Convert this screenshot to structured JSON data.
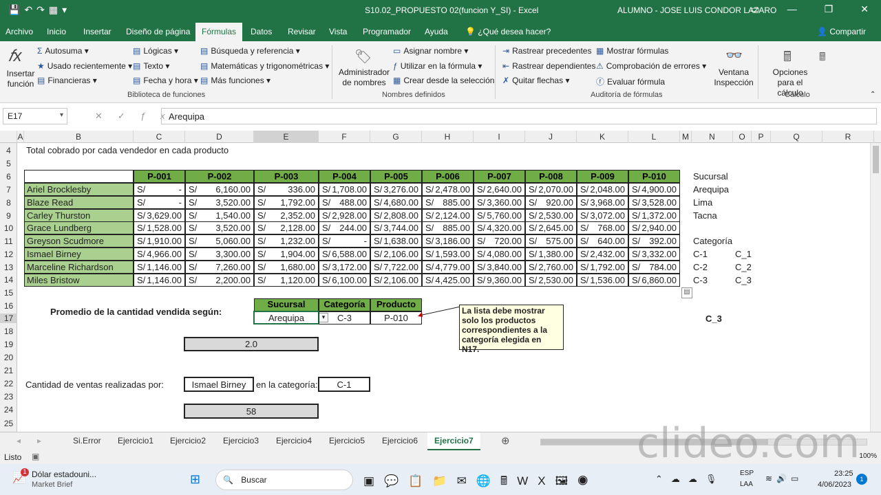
{
  "titlebar": {
    "file": "S10.02_PROPUESTO 02(funcion Y_SI)  -  Excel",
    "user": "ALUMNO - JOSE LUIS CONDOR LAZARO"
  },
  "menu": {
    "tabs": [
      "Archivo",
      "Inicio",
      "Insertar",
      "Diseño de página",
      "Fórmulas",
      "Datos",
      "Revisar",
      "Vista",
      "Programador",
      "Ayuda"
    ],
    "tell": "¿Qué desea hacer?",
    "share": "Compartir"
  },
  "ribbon": {
    "insert_fn": "Insertar función",
    "lib": [
      "Autosuma",
      "Usado recientemente",
      "Financieras",
      "Lógicas",
      "Texto",
      "Fecha y hora",
      "Búsqueda y referencia",
      "Matemáticas y trigonométricas",
      "Más funciones"
    ],
    "lib_group": "Biblioteca de funciones",
    "names": [
      "Asignar nombre",
      "Utilizar en la fórmula",
      "Crear desde la selección"
    ],
    "admin": "Administrador de nombres",
    "names_group": "Nombres definidos",
    "audit": [
      "Rastrear precedentes",
      "Rastrear dependientes",
      "Quitar flechas",
      "Mostrar fórmulas",
      "Comprobación de errores",
      "Evaluar fórmula"
    ],
    "watch": "Ventana Inspección",
    "audit_group": "Auditoría de fórmulas",
    "calc": "Opciones para el cálculo",
    "calc_group": "Cálculo"
  },
  "formula": {
    "cell": "E17",
    "value": "Arequipa"
  },
  "columns": [
    "A",
    "B",
    "C",
    "D",
    "E",
    "F",
    "G",
    "H",
    "I",
    "J",
    "K",
    "L",
    "M",
    "N",
    "O",
    "P",
    "Q",
    "R"
  ],
  "rows": [
    "4",
    "5",
    "6",
    "7",
    "8",
    "9",
    "10",
    "11",
    "12",
    "13",
    "14",
    "15",
    "16",
    "17",
    "18",
    "19",
    "20",
    "21",
    "22",
    "23",
    "24",
    "25"
  ],
  "sheet": {
    "title": "Total cobrado por cada vendedor en cada producto",
    "products": [
      "P-001",
      "P-002",
      "P-003",
      "P-004",
      "P-005",
      "P-006",
      "P-007",
      "P-008",
      "P-009",
      "P-010"
    ],
    "currency": "S/",
    "sellers": [
      {
        "name": "Ariel Brocklesby",
        "v": [
          "-",
          "6,160.00",
          "336.00",
          "1,708.00",
          "3,276.00",
          "2,478.00",
          "2,640.00",
          "2,070.00",
          "2,048.00",
          "4,900.00"
        ]
      },
      {
        "name": "Blaze Read",
        "v": [
          "-",
          "3,520.00",
          "1,792.00",
          "488.00",
          "4,680.00",
          "885.00",
          "3,360.00",
          "920.00",
          "3,968.00",
          "3,528.00"
        ]
      },
      {
        "name": "Carley Thurston",
        "v": [
          "3,629.00",
          "1,540.00",
          "2,352.00",
          "2,928.00",
          "2,808.00",
          "2,124.00",
          "5,760.00",
          "2,530.00",
          "3,072.00",
          "1,372.00"
        ]
      },
      {
        "name": "Grace Lundberg",
        "v": [
          "1,528.00",
          "3,520.00",
          "2,128.00",
          "244.00",
          "3,744.00",
          "885.00",
          "4,320.00",
          "2,645.00",
          "768.00",
          "2,940.00"
        ]
      },
      {
        "name": "Greyson Scudmore",
        "v": [
          "1,910.00",
          "5,060.00",
          "1,232.00",
          "-",
          "1,638.00",
          "3,186.00",
          "720.00",
          "575.00",
          "640.00",
          "392.00"
        ]
      },
      {
        "name": "Ismael Birney",
        "v": [
          "4,966.00",
          "3,300.00",
          "1,904.00",
          "6,588.00",
          "2,106.00",
          "1,593.00",
          "4,080.00",
          "1,380.00",
          "2,432.00",
          "3,332.00"
        ]
      },
      {
        "name": "Marceline Richardson",
        "v": [
          "1,146.00",
          "7,260.00",
          "1,680.00",
          "3,172.00",
          "7,722.00",
          "4,779.00",
          "3,840.00",
          "2,760.00",
          "1,792.00",
          "784.00"
        ]
      },
      {
        "name": "Miles Bristow",
        "v": [
          "1,146.00",
          "2,200.00",
          "1,120.00",
          "6,100.00",
          "2,106.00",
          "4,425.00",
          "9,360.00",
          "2,530.00",
          "1,536.00",
          "6,860.00"
        ]
      }
    ],
    "side": {
      "suc_head": "Sucursal",
      "sucursales": [
        "Arequipa",
        "Lima",
        "Tacna"
      ],
      "cat_head": "Categoría",
      "cats": [
        "C-1",
        "C-2",
        "C-3"
      ],
      "cats2": [
        "C_1",
        "C_2",
        "C_3"
      ],
      "n17": "C_3"
    },
    "promedio_label": "Promedio de la cantidad vendida según:",
    "crit_heads": [
      "Sucursal",
      "Categoría",
      "Producto"
    ],
    "crit_vals": [
      "Arequipa",
      "C-3",
      "P-010"
    ],
    "promedio_val": "2.0",
    "note": "La lista debe mostrar solo los productos correspondientes a la categoría elegida en N17.",
    "cant_label": "Cantidad de ventas realizadas por:",
    "cant_name": "Ismael Birney",
    "cat_label": "en la categoría:",
    "cat_val": "C-1",
    "cant_val": "58"
  },
  "tabs": [
    "Si.Error",
    "Ejercicio1",
    "Ejercicio2",
    "Ejercicio3",
    "Ejercicio4",
    "Ejercicio5",
    "Ejercicio6",
    "Ejercicio7"
  ],
  "status": {
    "ready": "Listo",
    "zoom": "100%"
  },
  "taskbar": {
    "news_title": "Dólar estadouni...",
    "news_sub": "Market Brief",
    "search": "Buscar",
    "lang1": "ESP",
    "lang2": "LAA",
    "time": "23:25",
    "date": "4/06/2023",
    "badge": "1"
  },
  "watermark": "clideo.com"
}
